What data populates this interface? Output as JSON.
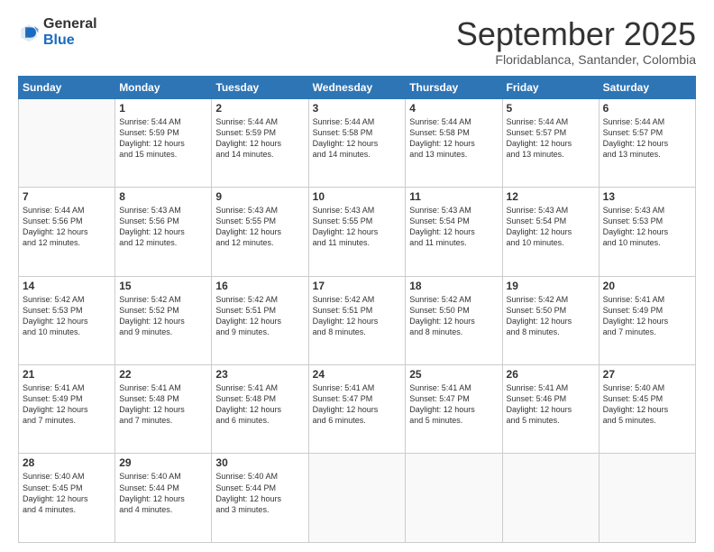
{
  "logo": {
    "general": "General",
    "blue": "Blue"
  },
  "header": {
    "month": "September 2025",
    "location": "Floridablanca, Santander, Colombia"
  },
  "weekdays": [
    "Sunday",
    "Monday",
    "Tuesday",
    "Wednesday",
    "Thursday",
    "Friday",
    "Saturday"
  ],
  "weeks": [
    [
      {
        "day": "",
        "info": ""
      },
      {
        "day": "1",
        "info": "Sunrise: 5:44 AM\nSunset: 5:59 PM\nDaylight: 12 hours\nand 15 minutes."
      },
      {
        "day": "2",
        "info": "Sunrise: 5:44 AM\nSunset: 5:59 PM\nDaylight: 12 hours\nand 14 minutes."
      },
      {
        "day": "3",
        "info": "Sunrise: 5:44 AM\nSunset: 5:58 PM\nDaylight: 12 hours\nand 14 minutes."
      },
      {
        "day": "4",
        "info": "Sunrise: 5:44 AM\nSunset: 5:58 PM\nDaylight: 12 hours\nand 13 minutes."
      },
      {
        "day": "5",
        "info": "Sunrise: 5:44 AM\nSunset: 5:57 PM\nDaylight: 12 hours\nand 13 minutes."
      },
      {
        "day": "6",
        "info": "Sunrise: 5:44 AM\nSunset: 5:57 PM\nDaylight: 12 hours\nand 13 minutes."
      }
    ],
    [
      {
        "day": "7",
        "info": "Sunrise: 5:44 AM\nSunset: 5:56 PM\nDaylight: 12 hours\nand 12 minutes."
      },
      {
        "day": "8",
        "info": "Sunrise: 5:43 AM\nSunset: 5:56 PM\nDaylight: 12 hours\nand 12 minutes."
      },
      {
        "day": "9",
        "info": "Sunrise: 5:43 AM\nSunset: 5:55 PM\nDaylight: 12 hours\nand 12 minutes."
      },
      {
        "day": "10",
        "info": "Sunrise: 5:43 AM\nSunset: 5:55 PM\nDaylight: 12 hours\nand 11 minutes."
      },
      {
        "day": "11",
        "info": "Sunrise: 5:43 AM\nSunset: 5:54 PM\nDaylight: 12 hours\nand 11 minutes."
      },
      {
        "day": "12",
        "info": "Sunrise: 5:43 AM\nSunset: 5:54 PM\nDaylight: 12 hours\nand 10 minutes."
      },
      {
        "day": "13",
        "info": "Sunrise: 5:43 AM\nSunset: 5:53 PM\nDaylight: 12 hours\nand 10 minutes."
      }
    ],
    [
      {
        "day": "14",
        "info": "Sunrise: 5:42 AM\nSunset: 5:53 PM\nDaylight: 12 hours\nand 10 minutes."
      },
      {
        "day": "15",
        "info": "Sunrise: 5:42 AM\nSunset: 5:52 PM\nDaylight: 12 hours\nand 9 minutes."
      },
      {
        "day": "16",
        "info": "Sunrise: 5:42 AM\nSunset: 5:51 PM\nDaylight: 12 hours\nand 9 minutes."
      },
      {
        "day": "17",
        "info": "Sunrise: 5:42 AM\nSunset: 5:51 PM\nDaylight: 12 hours\nand 8 minutes."
      },
      {
        "day": "18",
        "info": "Sunrise: 5:42 AM\nSunset: 5:50 PM\nDaylight: 12 hours\nand 8 minutes."
      },
      {
        "day": "19",
        "info": "Sunrise: 5:42 AM\nSunset: 5:50 PM\nDaylight: 12 hours\nand 8 minutes."
      },
      {
        "day": "20",
        "info": "Sunrise: 5:41 AM\nSunset: 5:49 PM\nDaylight: 12 hours\nand 7 minutes."
      }
    ],
    [
      {
        "day": "21",
        "info": "Sunrise: 5:41 AM\nSunset: 5:49 PM\nDaylight: 12 hours\nand 7 minutes."
      },
      {
        "day": "22",
        "info": "Sunrise: 5:41 AM\nSunset: 5:48 PM\nDaylight: 12 hours\nand 7 minutes."
      },
      {
        "day": "23",
        "info": "Sunrise: 5:41 AM\nSunset: 5:48 PM\nDaylight: 12 hours\nand 6 minutes."
      },
      {
        "day": "24",
        "info": "Sunrise: 5:41 AM\nSunset: 5:47 PM\nDaylight: 12 hours\nand 6 minutes."
      },
      {
        "day": "25",
        "info": "Sunrise: 5:41 AM\nSunset: 5:47 PM\nDaylight: 12 hours\nand 5 minutes."
      },
      {
        "day": "26",
        "info": "Sunrise: 5:41 AM\nSunset: 5:46 PM\nDaylight: 12 hours\nand 5 minutes."
      },
      {
        "day": "27",
        "info": "Sunrise: 5:40 AM\nSunset: 5:45 PM\nDaylight: 12 hours\nand 5 minutes."
      }
    ],
    [
      {
        "day": "28",
        "info": "Sunrise: 5:40 AM\nSunset: 5:45 PM\nDaylight: 12 hours\nand 4 minutes."
      },
      {
        "day": "29",
        "info": "Sunrise: 5:40 AM\nSunset: 5:44 PM\nDaylight: 12 hours\nand 4 minutes."
      },
      {
        "day": "30",
        "info": "Sunrise: 5:40 AM\nSunset: 5:44 PM\nDaylight: 12 hours\nand 3 minutes."
      },
      {
        "day": "",
        "info": ""
      },
      {
        "day": "",
        "info": ""
      },
      {
        "day": "",
        "info": ""
      },
      {
        "day": "",
        "info": ""
      }
    ]
  ]
}
